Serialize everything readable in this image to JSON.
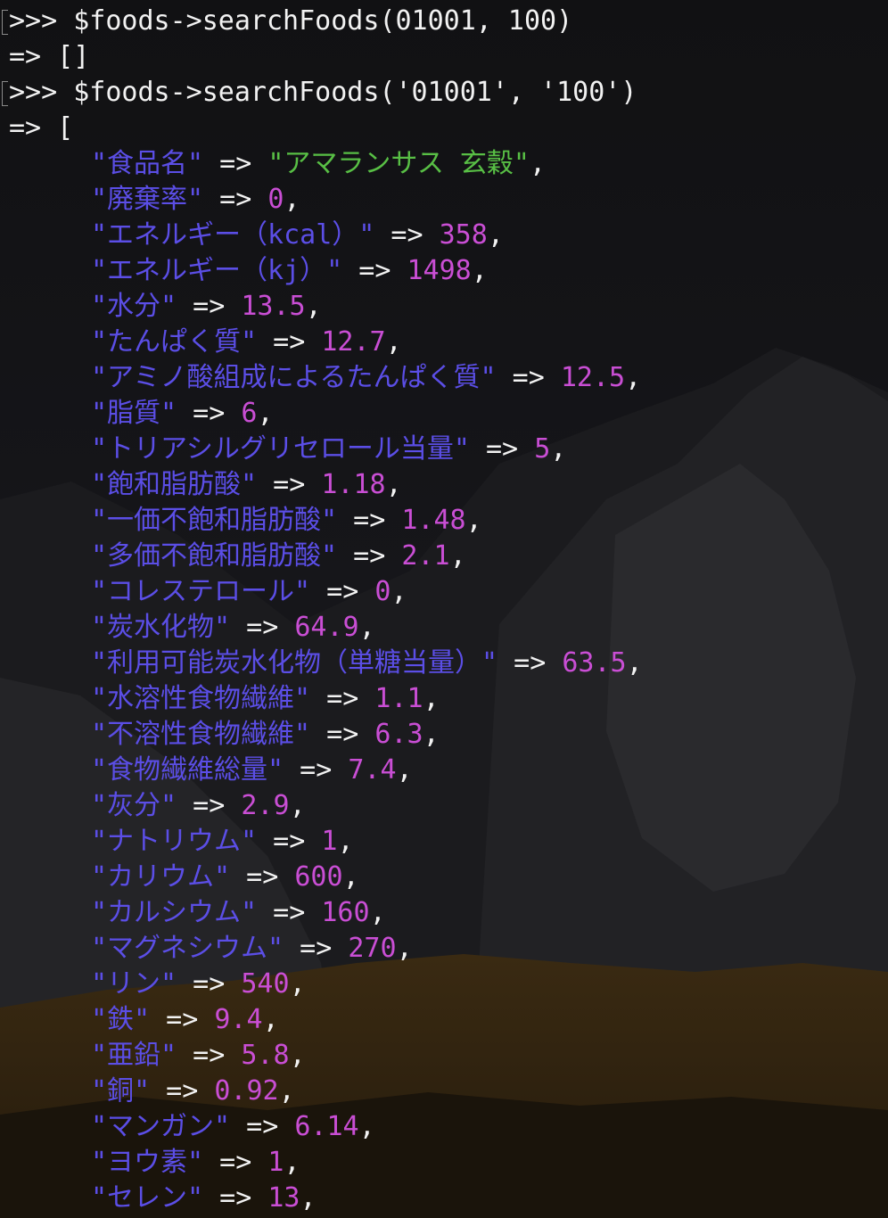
{
  "commands": [
    {
      "prompt": ">>> ",
      "text": "$foods->searchFoods(01001, 100)"
    },
    {
      "prompt": ">>> ",
      "text": "$foods->searchFoods('01001', '100')"
    }
  ],
  "results": {
    "empty": "=> []",
    "open": "=> ["
  },
  "arrow": " => ",
  "comma": ",",
  "entries": [
    {
      "key": "\"食品名\"",
      "value": "\"アマランサス 玄穀\"",
      "type": "string"
    },
    {
      "key": "\"廃棄率\"",
      "value": "0",
      "type": "number"
    },
    {
      "key": "\"エネルギー（kcal）\"",
      "value": "358",
      "type": "number"
    },
    {
      "key": "\"エネルギー（kj）\"",
      "value": "1498",
      "type": "number"
    },
    {
      "key": "\"水分\"",
      "value": "13.5",
      "type": "number"
    },
    {
      "key": "\"たんぱく質\"",
      "value": "12.7",
      "type": "number"
    },
    {
      "key": "\"アミノ酸組成によるたんぱく質\"",
      "value": "12.5",
      "type": "number"
    },
    {
      "key": "\"脂質\"",
      "value": "6",
      "type": "number"
    },
    {
      "key": "\"トリアシルグリセロール当量\"",
      "value": "5",
      "type": "number"
    },
    {
      "key": "\"飽和脂肪酸\"",
      "value": "1.18",
      "type": "number"
    },
    {
      "key": "\"一価不飽和脂肪酸\"",
      "value": "1.48",
      "type": "number"
    },
    {
      "key": "\"多価不飽和脂肪酸\"",
      "value": "2.1",
      "type": "number"
    },
    {
      "key": "\"コレステロール\"",
      "value": "0",
      "type": "number"
    },
    {
      "key": "\"炭水化物\"",
      "value": "64.9",
      "type": "number"
    },
    {
      "key": "\"利用可能炭水化物（単糖当量）\"",
      "value": "63.5",
      "type": "number"
    },
    {
      "key": "\"水溶性食物繊維\"",
      "value": "1.1",
      "type": "number"
    },
    {
      "key": "\"不溶性食物繊維\"",
      "value": "6.3",
      "type": "number"
    },
    {
      "key": "\"食物繊維総量\"",
      "value": "7.4",
      "type": "number"
    },
    {
      "key": "\"灰分\"",
      "value": "2.9",
      "type": "number"
    },
    {
      "key": "\"ナトリウム\"",
      "value": "1",
      "type": "number"
    },
    {
      "key": "\"カリウム\"",
      "value": "600",
      "type": "number"
    },
    {
      "key": "\"カルシウム\"",
      "value": "160",
      "type": "number"
    },
    {
      "key": "\"マグネシウム\"",
      "value": "270",
      "type": "number"
    },
    {
      "key": "\"リン\"",
      "value": "540",
      "type": "number"
    },
    {
      "key": "\"鉄\"",
      "value": "9.4",
      "type": "number"
    },
    {
      "key": "\"亜鉛\"",
      "value": "5.8",
      "type": "number"
    },
    {
      "key": "\"銅\"",
      "value": "0.92",
      "type": "number"
    },
    {
      "key": "\"マンガン\"",
      "value": "6.14",
      "type": "number"
    },
    {
      "key": "\"ヨウ素\"",
      "value": "1",
      "type": "number"
    },
    {
      "key": "\"セレン\"",
      "value": "13",
      "type": "number"
    }
  ],
  "colors": {
    "background": "#101012",
    "text": "#f2f2f2",
    "key": "#5b4ee6",
    "string": "#58bf45",
    "number": "#c94ed4"
  }
}
